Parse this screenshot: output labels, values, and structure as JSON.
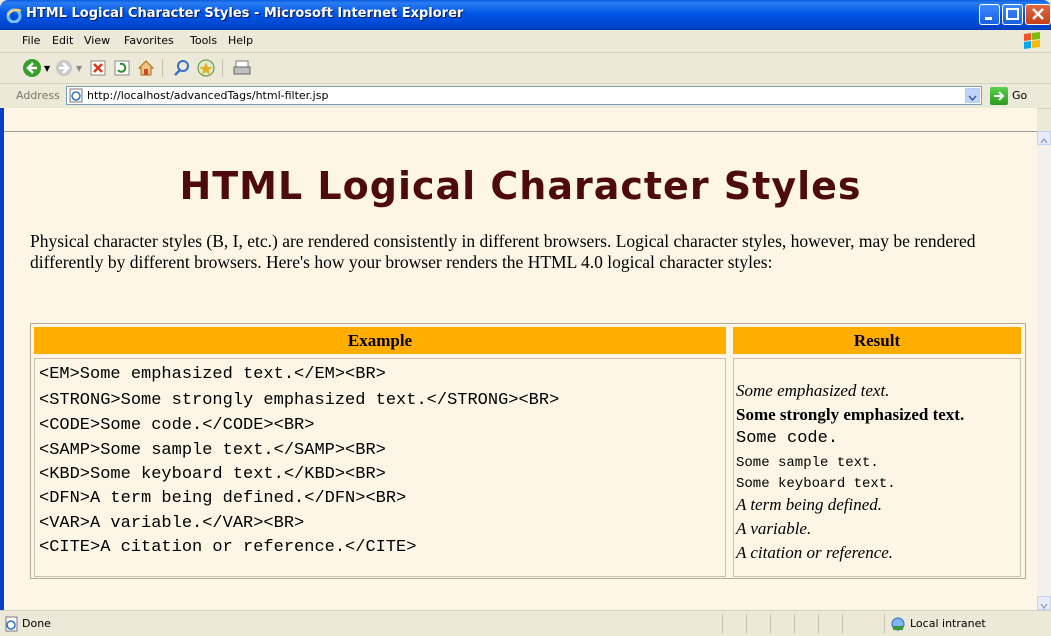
{
  "window": {
    "title": "HTML Logical Character Styles - Microsoft Internet Explorer"
  },
  "menu": [
    "File",
    "Edit",
    "View",
    "Favorites",
    "Tools",
    "Help"
  ],
  "toolbar": {
    "buttons": [
      "back-icon",
      "forward-icon",
      "stop-icon",
      "refresh-icon",
      "home-icon",
      "search-icon",
      "favorites-icon",
      "print-icon"
    ]
  },
  "address": {
    "label": "Address",
    "url": "http://localhost/advancedTags/html-filter.jsp",
    "go_label": "Go"
  },
  "page": {
    "title": "HTML Logical Character Styles",
    "intro": "Physical character styles (B, I, etc.) are rendered consistently in different browsers. Logical character styles, however, may be rendered differently by different browsers. Here's how your browser renders the HTML 4.0 logical character styles:",
    "table": {
      "headers": [
        "Example",
        "Result"
      ],
      "examples": [
        "<EM>Some emphasized text.</EM><BR>",
        "<STRONG>Some strongly emphasized text.</STRONG><BR>",
        "<CODE>Some code.</CODE><BR>",
        "<SAMP>Some sample text.</SAMP><BR>",
        "<KBD>Some keyboard text.</KBD><BR>",
        "<DFN>A term being defined.</DFN><BR>",
        "<VAR>A variable.</VAR><BR>",
        "<CITE>A citation or reference.</CITE>"
      ],
      "results": [
        "Some emphasized text.",
        "Some strongly emphasized text.",
        "Some code.",
        "Some sample text.",
        "Some keyboard text.",
        "A term being defined.",
        "A variable.",
        "A citation or reference."
      ]
    }
  },
  "status": {
    "text": "Done",
    "zone": "Local intranet"
  },
  "colors": {
    "title": "#4d0b0b",
    "header_bg": "#ffad00",
    "page_bg": "#fdf5e6"
  }
}
